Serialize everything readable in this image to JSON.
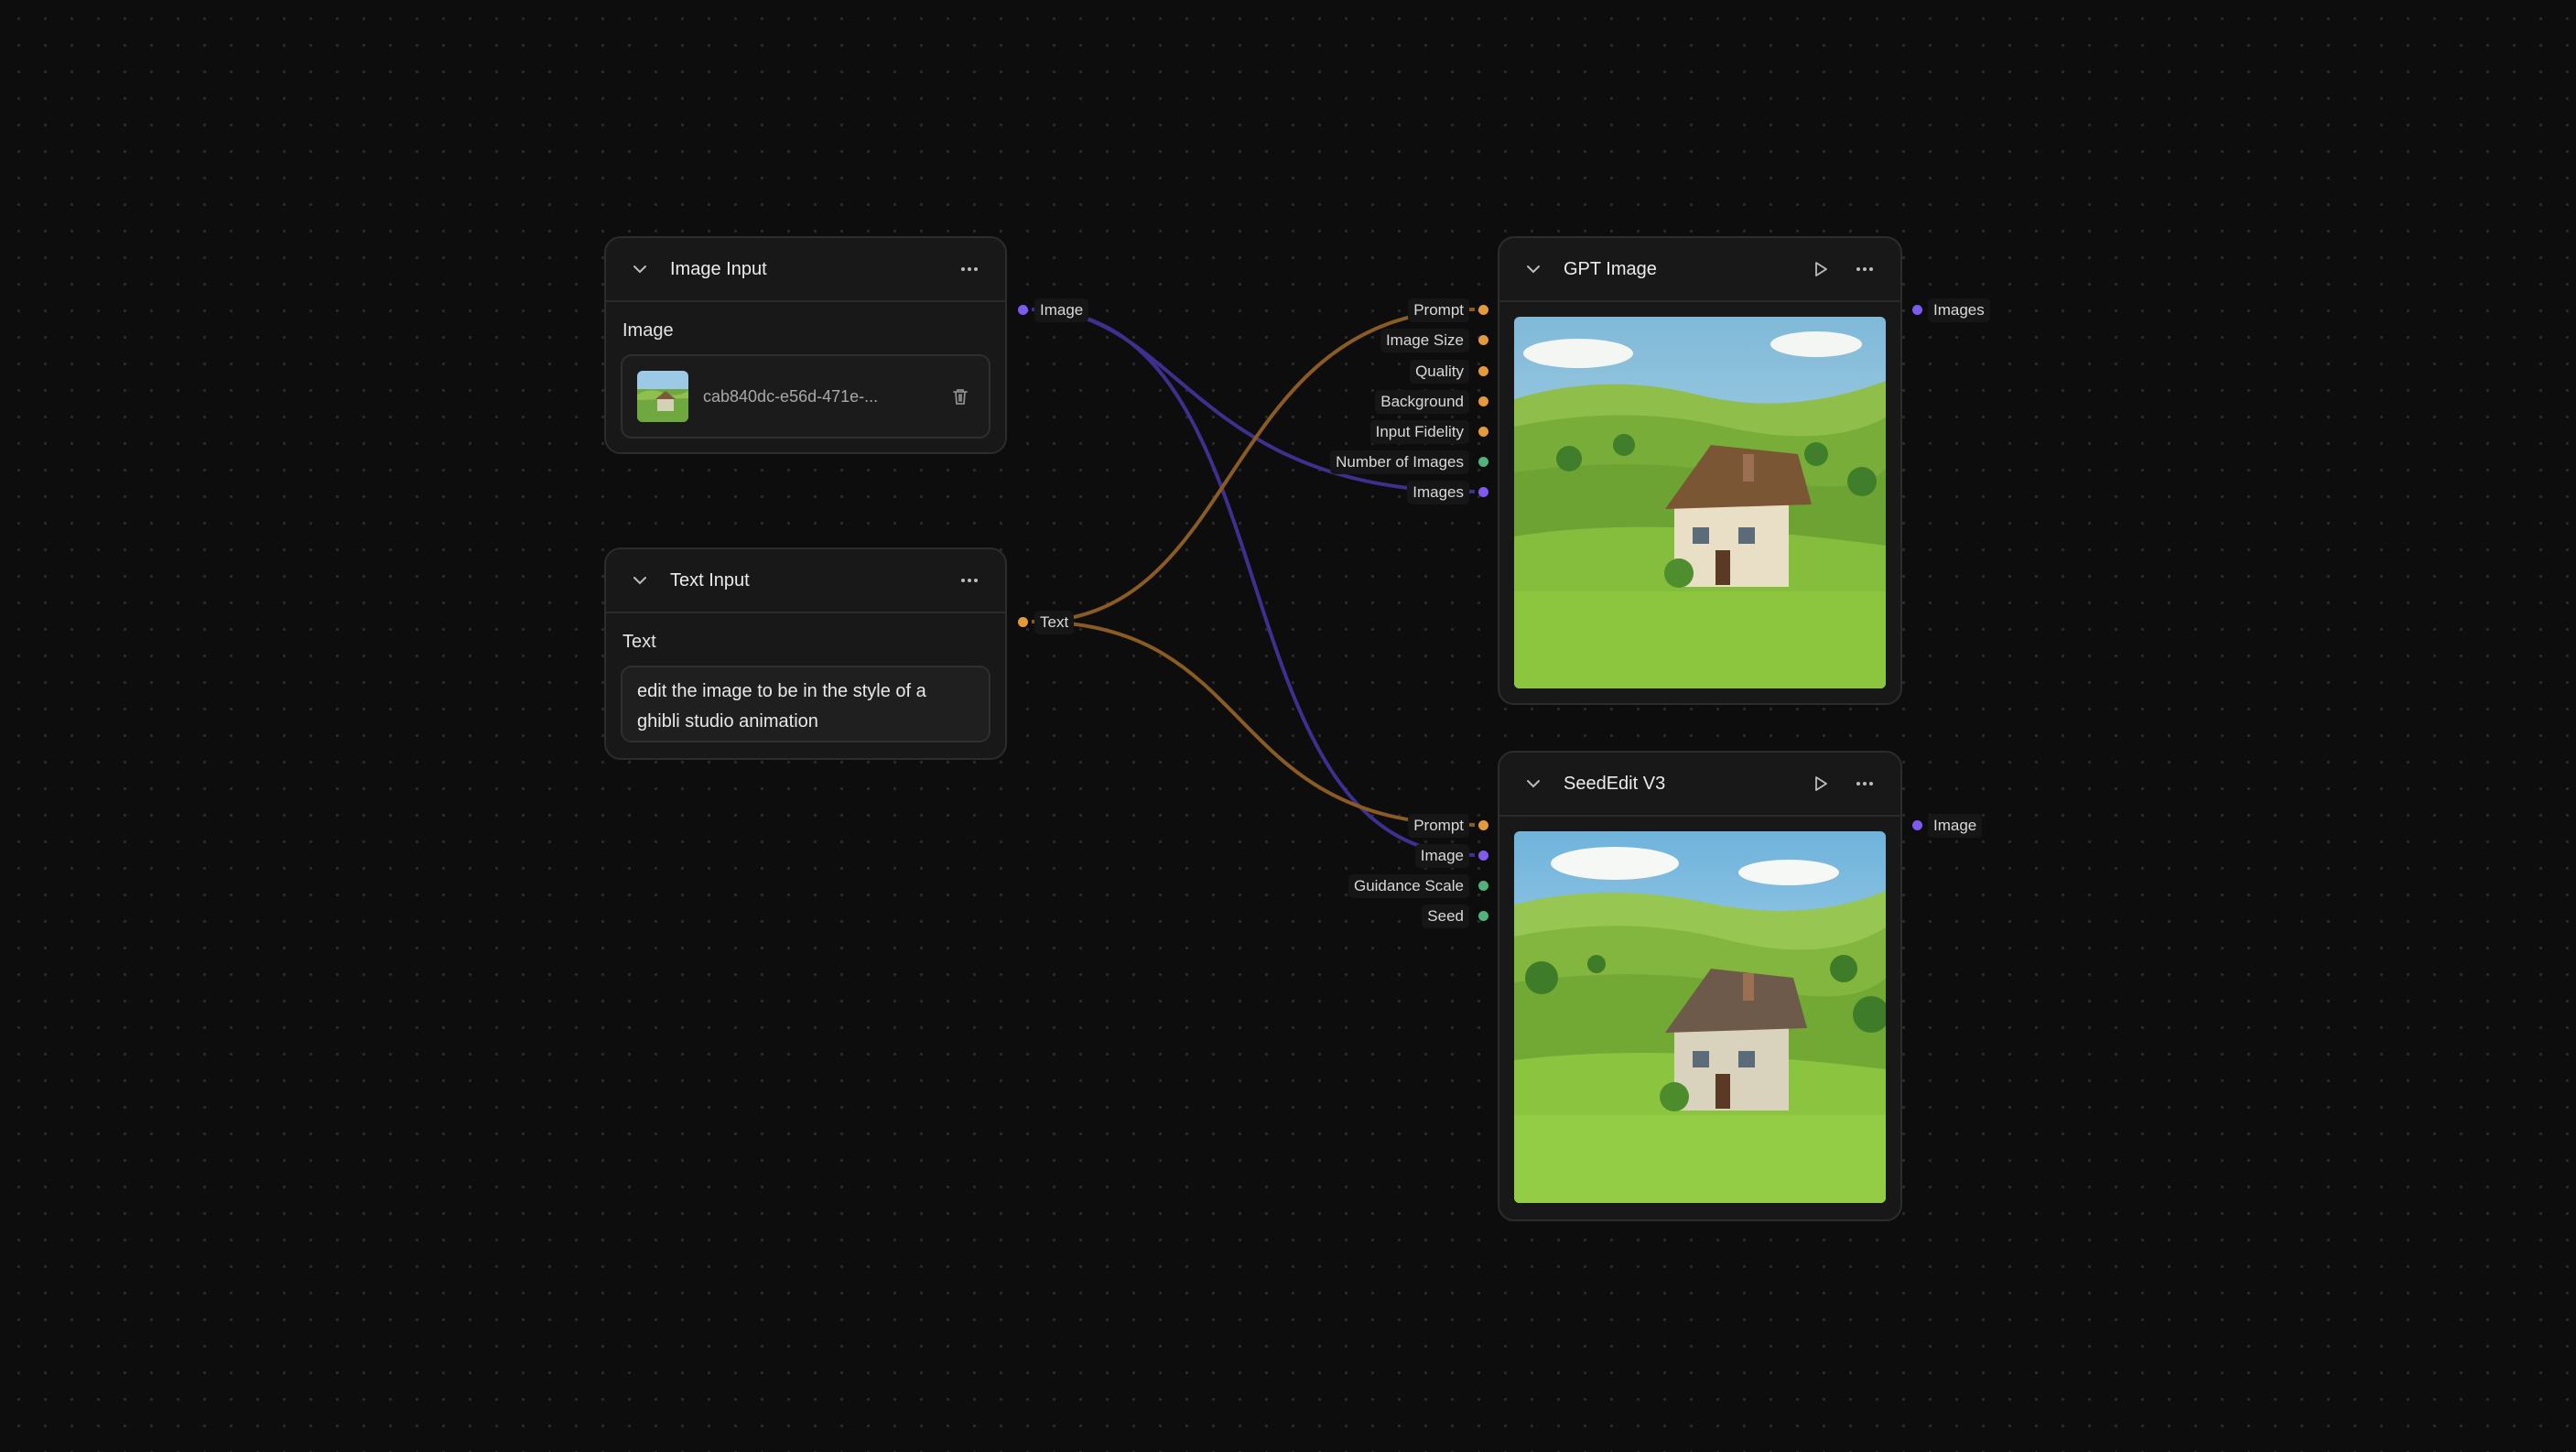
{
  "colors": {
    "background": "#0d0d0d",
    "image_port": "#7e5af0",
    "text_port": "#e39a3a",
    "number_port": "#4fb37a",
    "image_edge": "#3f2f8f",
    "text_edge": "#8a5b22"
  },
  "nodes": {
    "image_input": {
      "title": "Image Input",
      "field_label": "Image",
      "file_name": "cab840dc-e56d-471e-...",
      "output_label": "Image"
    },
    "text_input": {
      "title": "Text Input",
      "field_label": "Text",
      "text_value": "edit the image to be in the style of a\nghibli studio animation",
      "output_label": "Text"
    },
    "gpt_image": {
      "title": "GPT Image",
      "inputs": [
        "Prompt",
        "Image Size",
        "Quality",
        "Background",
        "Input Fidelity",
        "Number of Images",
        "Images"
      ],
      "output_label": "Images"
    },
    "seededit": {
      "title": "SeedEdit V3",
      "inputs": [
        "Prompt",
        "Image",
        "Guidance Scale",
        "Seed"
      ],
      "output_label": "Image"
    }
  },
  "icons": {
    "collapse": "chevron-down-icon",
    "menu": "ellipsis-icon",
    "run": "play-icon",
    "delete": "trash-icon"
  }
}
